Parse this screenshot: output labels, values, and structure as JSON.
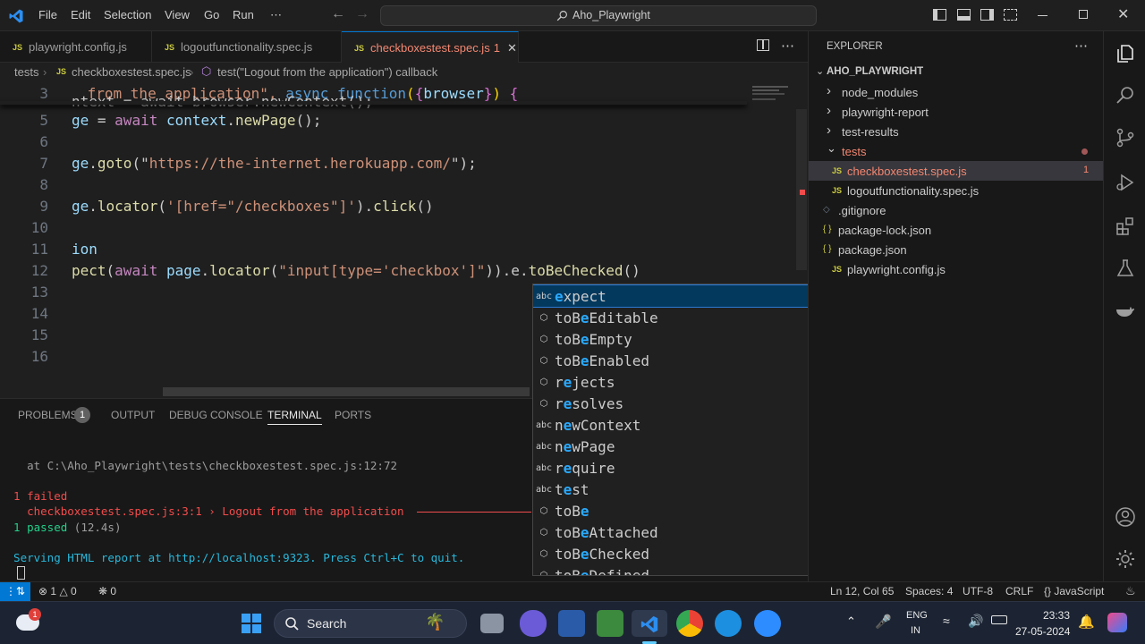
{
  "titlebar": {
    "menu": [
      "File",
      "Edit",
      "Selection",
      "View",
      "Go",
      "Run",
      "⋯"
    ],
    "search": "Aho_Playwright"
  },
  "tabs": [
    {
      "badge": "JS",
      "label": "playwright.config.js"
    },
    {
      "badge": "JS",
      "label": "logoutfunctionality.spec.js"
    },
    {
      "badge": "JS",
      "label": "checkboxestest.spec.js",
      "problems": "1",
      "close": "✕"
    }
  ],
  "breadcrumb": {
    "folder": "tests",
    "file": "checkboxestest.spec.js",
    "symbol": "test(\"Logout from the application\") callback"
  },
  "editor": {
    "lines": [
      {
        "n": "3",
        "parts": [
          {
            "t": " from the application\", ",
            "c": "str"
          },
          {
            "t": "async ",
            "c": "kb"
          },
          {
            "t": "function",
            "c": "kb"
          },
          {
            "t": "(",
            "c": "yb"
          },
          {
            "t": "{",
            "c": "pb"
          },
          {
            "t": "browser",
            "c": "var"
          },
          {
            "t": "}",
            "c": "pb"
          },
          {
            "t": ")",
            "c": "yb"
          },
          {
            "t": " {",
            "c": "pb"
          }
        ]
      },
      {
        "n": "4",
        "parts": [
          {
            "t": "ntext = await browser.newContext();",
            "c": ""
          }
        ]
      },
      {
        "n": "5",
        "parts": [
          {
            "t": "ge",
            "c": "var"
          },
          {
            "t": " = ",
            "c": ""
          },
          {
            "t": "await ",
            "c": "kw"
          },
          {
            "t": "context",
            "c": "var"
          },
          {
            "t": ".",
            "c": ""
          },
          {
            "t": "newPage",
            "c": "fn"
          },
          {
            "t": "();",
            "c": ""
          }
        ]
      },
      {
        "n": "6",
        "parts": []
      },
      {
        "n": "7",
        "parts": [
          {
            "t": "ge",
            "c": "var"
          },
          {
            "t": ".",
            "c": ""
          },
          {
            "t": "goto",
            "c": "fn"
          },
          {
            "t": "(\"",
            "c": ""
          },
          {
            "t": "https://the-internet.herokuapp.com/",
            "c": "str"
          },
          {
            "t": "\");",
            "c": ""
          }
        ]
      },
      {
        "n": "8",
        "parts": []
      },
      {
        "n": "9",
        "parts": [
          {
            "t": "ge",
            "c": "var"
          },
          {
            "t": ".",
            "c": ""
          },
          {
            "t": "locator",
            "c": "fn"
          },
          {
            "t": "(",
            "c": ""
          },
          {
            "t": "'[href=\"/checkboxes\"]'",
            "c": "str"
          },
          {
            "t": ").",
            "c": ""
          },
          {
            "t": "click",
            "c": "fn"
          },
          {
            "t": "()",
            "c": ""
          }
        ]
      },
      {
        "n": "10",
        "parts": []
      },
      {
        "n": "11",
        "parts": [
          {
            "t": "ion",
            "c": "var"
          }
        ]
      },
      {
        "n": "12",
        "parts": [
          {
            "t": "pect",
            "c": "fn"
          },
          {
            "t": "(",
            "c": ""
          },
          {
            "t": "await ",
            "c": "kw"
          },
          {
            "t": "page",
            "c": "var"
          },
          {
            "t": ".",
            "c": ""
          },
          {
            "t": "locator",
            "c": "fn"
          },
          {
            "t": "(",
            "c": ""
          },
          {
            "t": "\"input[type='checkbox']\"",
            "c": "str"
          },
          {
            "t": ")).e.",
            "c": ""
          },
          {
            "t": "toBeChecked",
            "c": "fn"
          },
          {
            "t": "()",
            "c": ""
          }
        ]
      },
      {
        "n": "13",
        "parts": []
      },
      {
        "n": "14",
        "parts": []
      },
      {
        "n": "15",
        "parts": []
      },
      {
        "n": "16",
        "parts": []
      }
    ]
  },
  "suggestions": [
    {
      "icon": "abc",
      "pre": "",
      "match": "e",
      "rest": "xpect",
      "selected": true
    },
    {
      "icon": "⬡",
      "pre": "toB",
      "match": "e",
      "rest": "Editable"
    },
    {
      "icon": "⬡",
      "pre": "toB",
      "match": "e",
      "rest": "Empty"
    },
    {
      "icon": "⬡",
      "pre": "toB",
      "match": "e",
      "rest": "Enabled"
    },
    {
      "icon": "⬡",
      "pre": "r",
      "match": "e",
      "rest": "jects"
    },
    {
      "icon": "⬡",
      "pre": "r",
      "match": "e",
      "rest": "solves"
    },
    {
      "icon": "abc",
      "pre": "n",
      "match": "e",
      "rest": "wContext"
    },
    {
      "icon": "abc",
      "pre": "n",
      "match": "e",
      "rest": "wPage"
    },
    {
      "icon": "abc",
      "pre": "r",
      "match": "e",
      "rest": "quire"
    },
    {
      "icon": "abc",
      "pre": "t",
      "match": "e",
      "rest": "st"
    },
    {
      "icon": "⬡",
      "pre": "toB",
      "match": "e",
      "rest": ""
    },
    {
      "icon": "⬡",
      "pre": "toB",
      "match": "e",
      "rest": "Attached"
    },
    {
      "icon": "⬡",
      "pre": "toB",
      "match": "e",
      "rest": "Checked"
    },
    {
      "icon": "⬡",
      "pre": "toB",
      "match": "e",
      "rest": "Defined"
    }
  ],
  "panel": {
    "tabs": [
      "PROBLEMS",
      "OUTPUT",
      "DEBUG CONSOLE",
      "TERMINAL",
      "PORTS"
    ],
    "problems_count": "1",
    "terminal": {
      "at_line": "    at C:\\Aho_Playwright\\tests\\checkboxestest.spec.js:12:72",
      "failed": "  1 failed",
      "failed_detail": "    checkboxestest.spec.js:3:1 › Logout from the application",
      "passed": "  1 passed",
      "passed_time": " (12.4s)",
      "serving": "  Serving HTML report at http://localhost:9323. Press Ctrl+C to quit."
    }
  },
  "explorer": {
    "title": "EXPLORER",
    "root": "AHO_PLAYWRIGHT",
    "items": [
      {
        "label": "node_modules",
        "type": "folder"
      },
      {
        "label": "playwright-report",
        "type": "folder"
      },
      {
        "label": "test-results",
        "type": "folder"
      },
      {
        "label": "tests",
        "type": "folder-open"
      },
      {
        "label": "checkboxestest.spec.js",
        "type": "js",
        "badge": "1"
      },
      {
        "label": "logoutfunctionality.spec.js",
        "type": "js"
      },
      {
        "label": ".gitignore",
        "type": "git"
      },
      {
        "label": "package-lock.json",
        "type": "json"
      },
      {
        "label": "package.json",
        "type": "json"
      },
      {
        "label": "playwright.config.js",
        "type": "js"
      }
    ]
  },
  "status": {
    "errors": "1",
    "warnings": "0",
    "ports": "0",
    "position": "Ln 12, Col 65",
    "spaces": "Spaces: 4",
    "encoding": "UTF-8",
    "eol": "CRLF",
    "language": "JavaScript"
  },
  "taskbar": {
    "search": "Search",
    "lang_line1": "ENG",
    "lang_line2": "IN",
    "time": "23:33",
    "date": "27-05-2024",
    "weather_badge": "1"
  },
  "colors": {
    "accent": "#0078d4",
    "error": "#f14c4c",
    "string": "#ce9178",
    "keyword": "#c586c0",
    "function": "#dcdcaa"
  }
}
